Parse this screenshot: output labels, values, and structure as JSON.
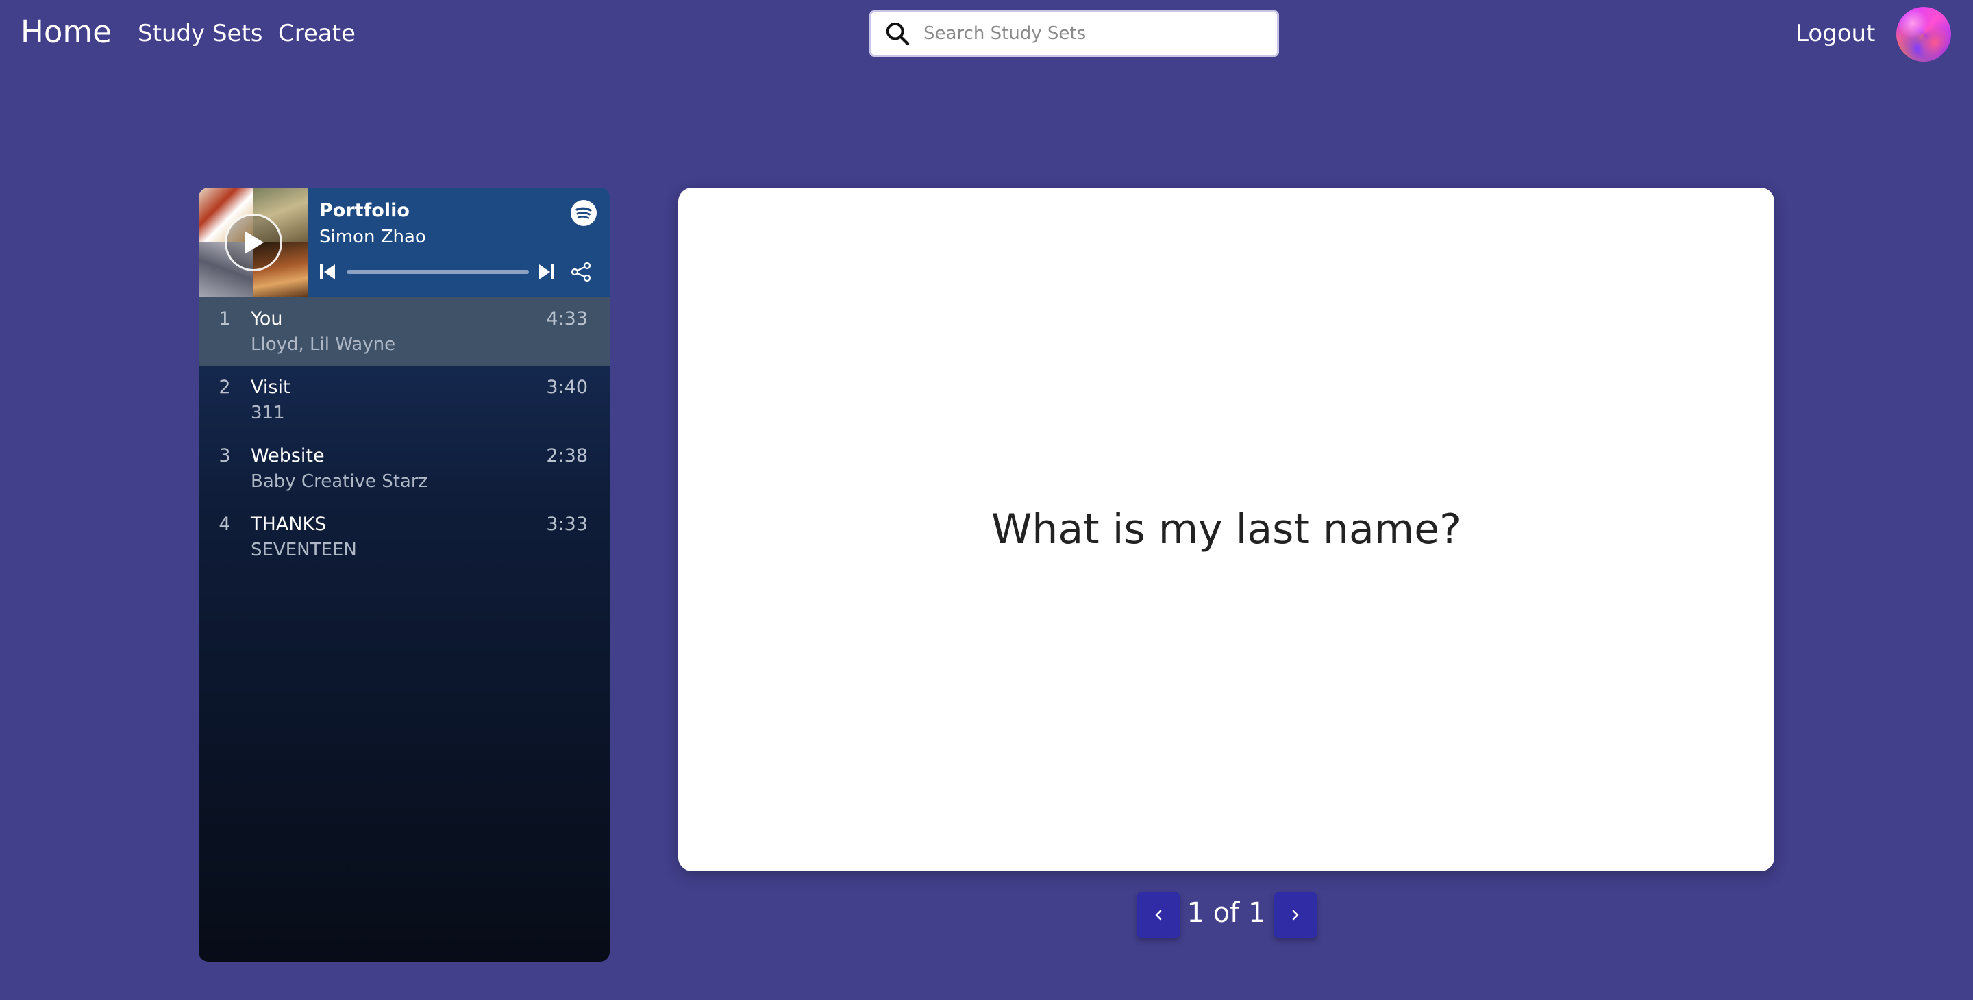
{
  "nav": {
    "home": "Home",
    "study_sets": "Study Sets",
    "create": "Create",
    "search_placeholder": "Search Study Sets",
    "logout": "Logout"
  },
  "player": {
    "title": "Portfolio",
    "artist": "Simon Zhao",
    "tracks": [
      {
        "num": "1",
        "name": "You",
        "artist": "Lloyd, Lil Wayne",
        "duration": "4:33",
        "active": true
      },
      {
        "num": "2",
        "name": "Visit",
        "artist": "311",
        "duration": "3:40",
        "active": false
      },
      {
        "num": "3",
        "name": "Website",
        "artist": "Baby Creative Starz",
        "duration": "2:38",
        "active": false
      },
      {
        "num": "4",
        "name": "THANKS",
        "artist": "SEVENTEEN",
        "duration": "3:33",
        "active": false
      }
    ]
  },
  "card": {
    "question": "What is my last name?"
  },
  "pager": {
    "text": "1 of 1"
  },
  "colors": {
    "background": "#423f8b",
    "pager_button": "#2f2ca6",
    "player_header": "#1e4a84"
  },
  "icons": {
    "search": "search-icon",
    "play": "play-icon",
    "spotify": "spotify-icon",
    "previous": "skip-previous-icon",
    "next": "skip-next-icon",
    "share": "share-icon",
    "pager_prev": "chevron-left-icon",
    "pager_next": "chevron-right-icon"
  }
}
